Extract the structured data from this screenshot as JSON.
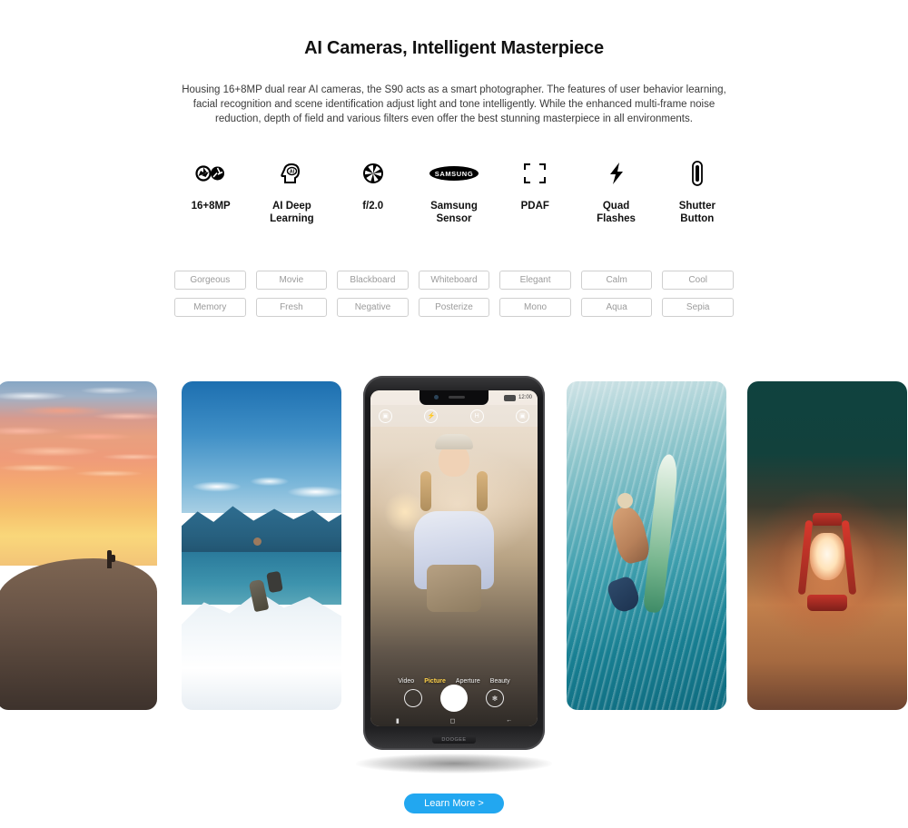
{
  "header": {
    "title": "AI Cameras, Intelligent Masterpiece",
    "description": "Housing 16+8MP dual rear AI cameras, the S90 acts as a smart photographer. The features of user behavior learning, facial recognition and scene identification adjust light and tone intelligently. While the enhanced multi-frame noise reduction, depth of field and various filters even offer the best stunning masterpiece in all environments."
  },
  "features": [
    {
      "icon": "dual-aperture-icon",
      "label": "16+8MP"
    },
    {
      "icon": "ai-head-icon",
      "label": "AI Deep\nLearning"
    },
    {
      "icon": "aperture-icon",
      "label": "f/2.0"
    },
    {
      "icon": "samsung-logo-icon",
      "label": "Samsung\nSensor"
    },
    {
      "icon": "focus-brackets-icon",
      "label": "PDAF"
    },
    {
      "icon": "lightning-bolt-icon",
      "label": "Quad\nFlashes"
    },
    {
      "icon": "shutter-pill-icon",
      "label": "Shutter\nButton"
    }
  ],
  "filters": [
    "Gorgeous",
    "Movie",
    "Blackboard",
    "Whiteboard",
    "Elegant",
    "Calm",
    "Cool",
    "Memory",
    "Fresh",
    "Negative",
    "Posterize",
    "Mono",
    "Aqua",
    "Sepia"
  ],
  "gallery": [
    {
      "name": "desert-sunset-photo",
      "subject": "Hiker silhouette on desert dune at sunset"
    },
    {
      "name": "mountain-hiker-photo",
      "subject": "Backpacker hiking snowy mountain ridge"
    },
    {
      "name": "underwater-surfer-photo",
      "subject": "Surfer diving underwater with surfboard"
    },
    {
      "name": "red-lantern-photo",
      "subject": "Glowing red lantern on sand at dusk"
    }
  ],
  "phone": {
    "brand": "DOOGEE",
    "status": {
      "time": "12:00",
      "battery": "battery-icon"
    },
    "camera_top_icons": [
      "scene-mode-icon",
      "flash-icon",
      "hdr-icon",
      "switch-camera-icon"
    ],
    "modes": [
      "Video",
      "Picture",
      "Aperture",
      "Beauty"
    ],
    "active_mode": "Picture",
    "controls": {
      "gallery_thumb": "gallery-thumbnail",
      "shutter": "shutter-button",
      "filter": "filter-button"
    },
    "navbar": [
      "recents",
      "home",
      "back"
    ]
  },
  "cta": {
    "label": "Learn More >",
    "color": "#22a7f0"
  }
}
